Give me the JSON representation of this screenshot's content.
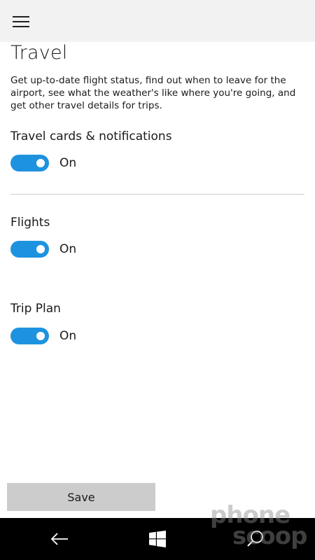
{
  "header": {
    "menu_icon": "hamburger-menu-icon"
  },
  "page": {
    "title": "Travel",
    "description": "Get up-to-date flight status, find out when to leave for the airport, see what the weather's like where you're going, and get other travel details for trips."
  },
  "settings": [
    {
      "label": "Travel cards & notifications",
      "state": "On",
      "enabled": true
    },
    {
      "label": "Flights",
      "state": "On",
      "enabled": true
    },
    {
      "label": "Trip Plan",
      "state": "On",
      "enabled": true
    }
  ],
  "actions": {
    "save_label": "Save"
  },
  "navbar": {
    "back_icon": "back-arrow-icon",
    "start_icon": "windows-logo-icon",
    "search_icon": "search-icon"
  },
  "watermark": {
    "line1": "phone",
    "line2": "scoop"
  },
  "colors": {
    "accent": "#1d93e0",
    "topbar": "#f2f2f2",
    "navbar": "#000000",
    "button": "#cccccc"
  }
}
